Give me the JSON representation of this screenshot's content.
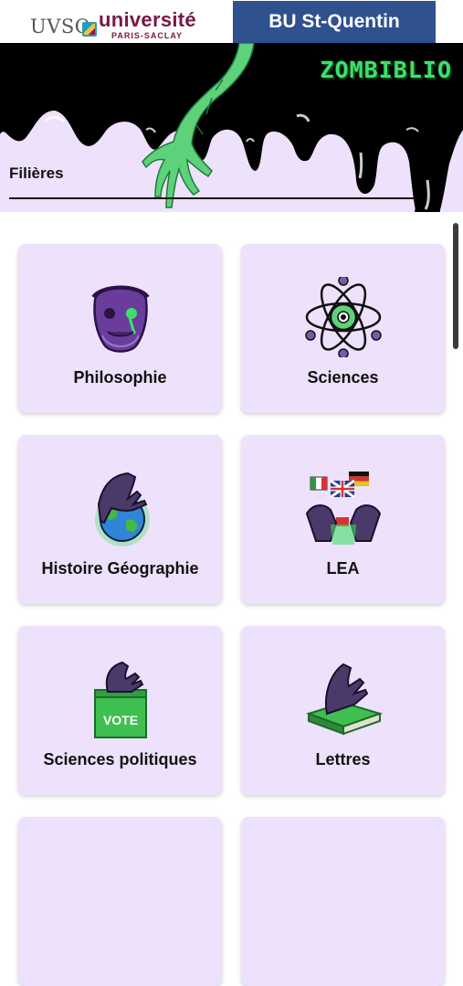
{
  "header": {
    "logo_left": "UVSQ",
    "logo_university": "université",
    "logo_sub": "PARIS-SACLAY",
    "library_button": "BU St-Quentin"
  },
  "banner": {
    "brand": "ZOMBIBLIO",
    "section_title": "Filières"
  },
  "colors": {
    "banner_bg": "#ede1fb",
    "card_bg": "#ede1fb",
    "button_blue": "#2f5190",
    "zombie_green": "#3ee06b",
    "drip_black": "#000000"
  },
  "cards": [
    {
      "label": "Philosophie",
      "icon": "zombie-philosopher-bust-icon"
    },
    {
      "label": "Sciences",
      "icon": "atom-eyeball-icon"
    },
    {
      "label": "Histoire Géographie",
      "icon": "zombie-hand-globe-icon"
    },
    {
      "label": "LEA",
      "icon": "zombie-hands-flags-icon"
    },
    {
      "label": "Sciences politiques",
      "icon": "zombie-hand-ballot-box-icon"
    },
    {
      "label": "Lettres",
      "icon": "zombie-hand-book-icon"
    }
  ],
  "ballot_text": "VOTE"
}
